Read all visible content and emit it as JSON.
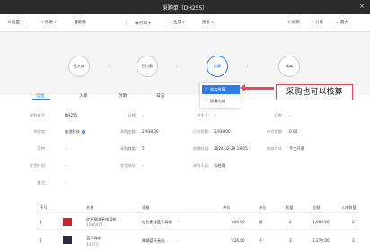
{
  "window": {
    "title": "采购单（DH255）",
    "close": "×"
  },
  "toolbar": {
    "left": [
      {
        "icon": "⚙",
        "label": "设置 ▾"
      },
      {
        "icon": "✎",
        "label": "修改 ▾"
      },
      {
        "icon": "🗑",
        "label": "删除"
      },
      {
        "icon": "🖶",
        "label": "打印 ▾"
      },
      {
        "icon": "+",
        "label": "生成 ▾"
      },
      {
        "icon": "",
        "label": "更多 ▾"
      }
    ],
    "right": [
      {
        "icon": "↻",
        "label": "刷新"
      },
      {
        "icon": "⇪",
        "label": "分享"
      },
      {
        "icon": "⤢",
        "label": "最大"
      }
    ]
  },
  "flow": {
    "nodes": [
      "已入库",
      "已付款",
      "核算",
      "成本"
    ],
    "arrow": "›"
  },
  "dropdown": {
    "items": [
      {
        "label": "成本核算",
        "check": "✓",
        "selected": true
      },
      {
        "label": "核算完成",
        "check": "✓",
        "selected": false
      }
    ]
  },
  "callout": "采购也可以核算",
  "tabs": [
    "信息",
    "入库",
    "付款",
    "日志"
  ],
  "fields": {
    "order_no_label": "采购单号：",
    "order_no": "DH255",
    "date_label": "日期：",
    "date": "-",
    "employee_label": "经手人：",
    "employee": "-",
    "warehouse_label": "仓库：",
    "warehouse": "-",
    "project_label": "项目：",
    "project": "-",
    "supplier_label": "供应商：",
    "supplier": "佳创科技",
    "amount_label": "采购金额：",
    "amount": "2,938.00",
    "paid_label": "已付金额：",
    "paid": "2,938.00",
    "unpaid_label": "待付金额：",
    "unpaid": "0.00",
    "currency_label": "币种：",
    "currency": "-",
    "type_label": "采购类型：",
    "type": "-",
    "qty_label": "采购数量：",
    "qty": "5",
    "time_label": "创建时间：",
    "time": "2024-02-29 18:05",
    "method_label": "审核方式：",
    "method": "手工开票",
    "status_label": "交货时间：",
    "status": "-",
    "dept_label": "交货地址：",
    "dept": "-",
    "creator_label": "采购人员：",
    "creator": "张经理",
    "remark_label": "备注：",
    "remark": "-"
  },
  "table": {
    "headers": [
      "序号",
      "名称",
      "规格",
      "单价",
      "单位",
      "数量",
      "金额",
      "入库数量"
    ],
    "rows": [
      {
        "no": "1",
        "name": "红色潮流无线耳机",
        "code": "1006473",
        "spec": "红色无线蓝牙耳机",
        "sep": "-",
        "price": "830.00",
        "unit": "副",
        "qty": "2",
        "amount": "1,660.00",
        "in": "2"
      },
      {
        "no": "2",
        "name": "蓝牙耳机",
        "code": "10471",
        "spec": "降噪蓝牙无线...",
        "sep": "-",
        "price": "426.00",
        "unit": "个",
        "qty": "3",
        "amount": "1,278.00",
        "in": "3"
      }
    ]
  }
}
